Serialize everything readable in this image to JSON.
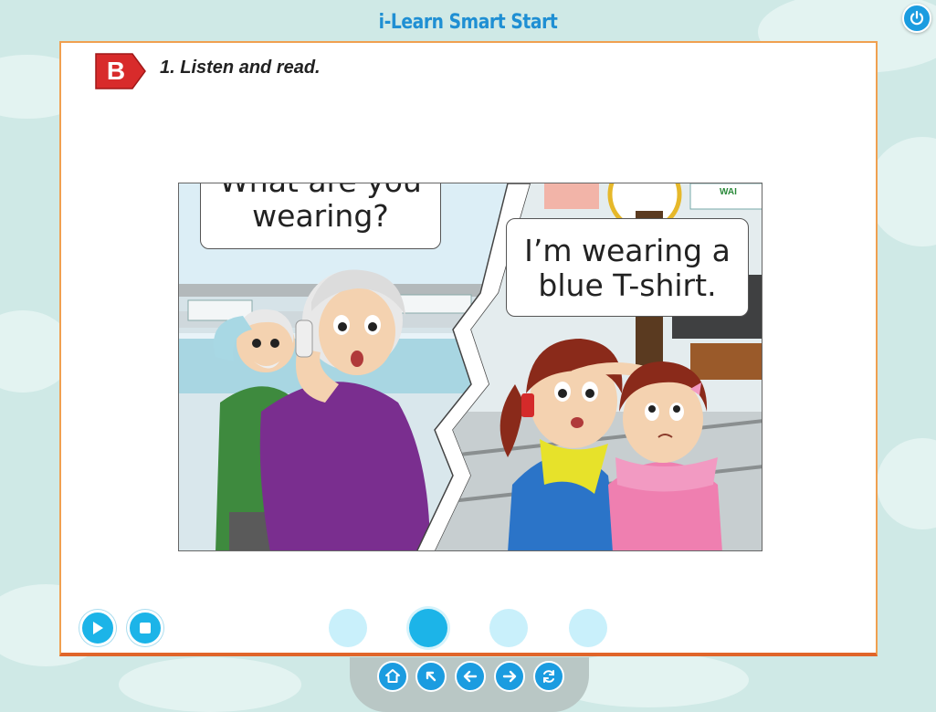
{
  "app": {
    "title": "i-Learn Smart Start"
  },
  "section": {
    "letter": "B",
    "instruction": "1. Listen and read."
  },
  "comic": {
    "speech1": [
      "What are you",
      "wearing?"
    ],
    "speech2": [
      "I’m wearing a",
      "blue T-shirt."
    ],
    "sign_text": "WAI"
  },
  "player": {
    "play_icon": "play-icon",
    "stop_icon": "stop-icon"
  },
  "pagination": {
    "total": 4,
    "active": 2
  },
  "nav": {
    "icons": [
      "home-icon",
      "back-arrow-icon",
      "previous-icon",
      "next-icon",
      "refresh-icon"
    ]
  },
  "colors": {
    "accent": "#1cb4e8",
    "title": "#1f8fd3",
    "badge": "#d82b2b",
    "border": "#f0a050"
  }
}
